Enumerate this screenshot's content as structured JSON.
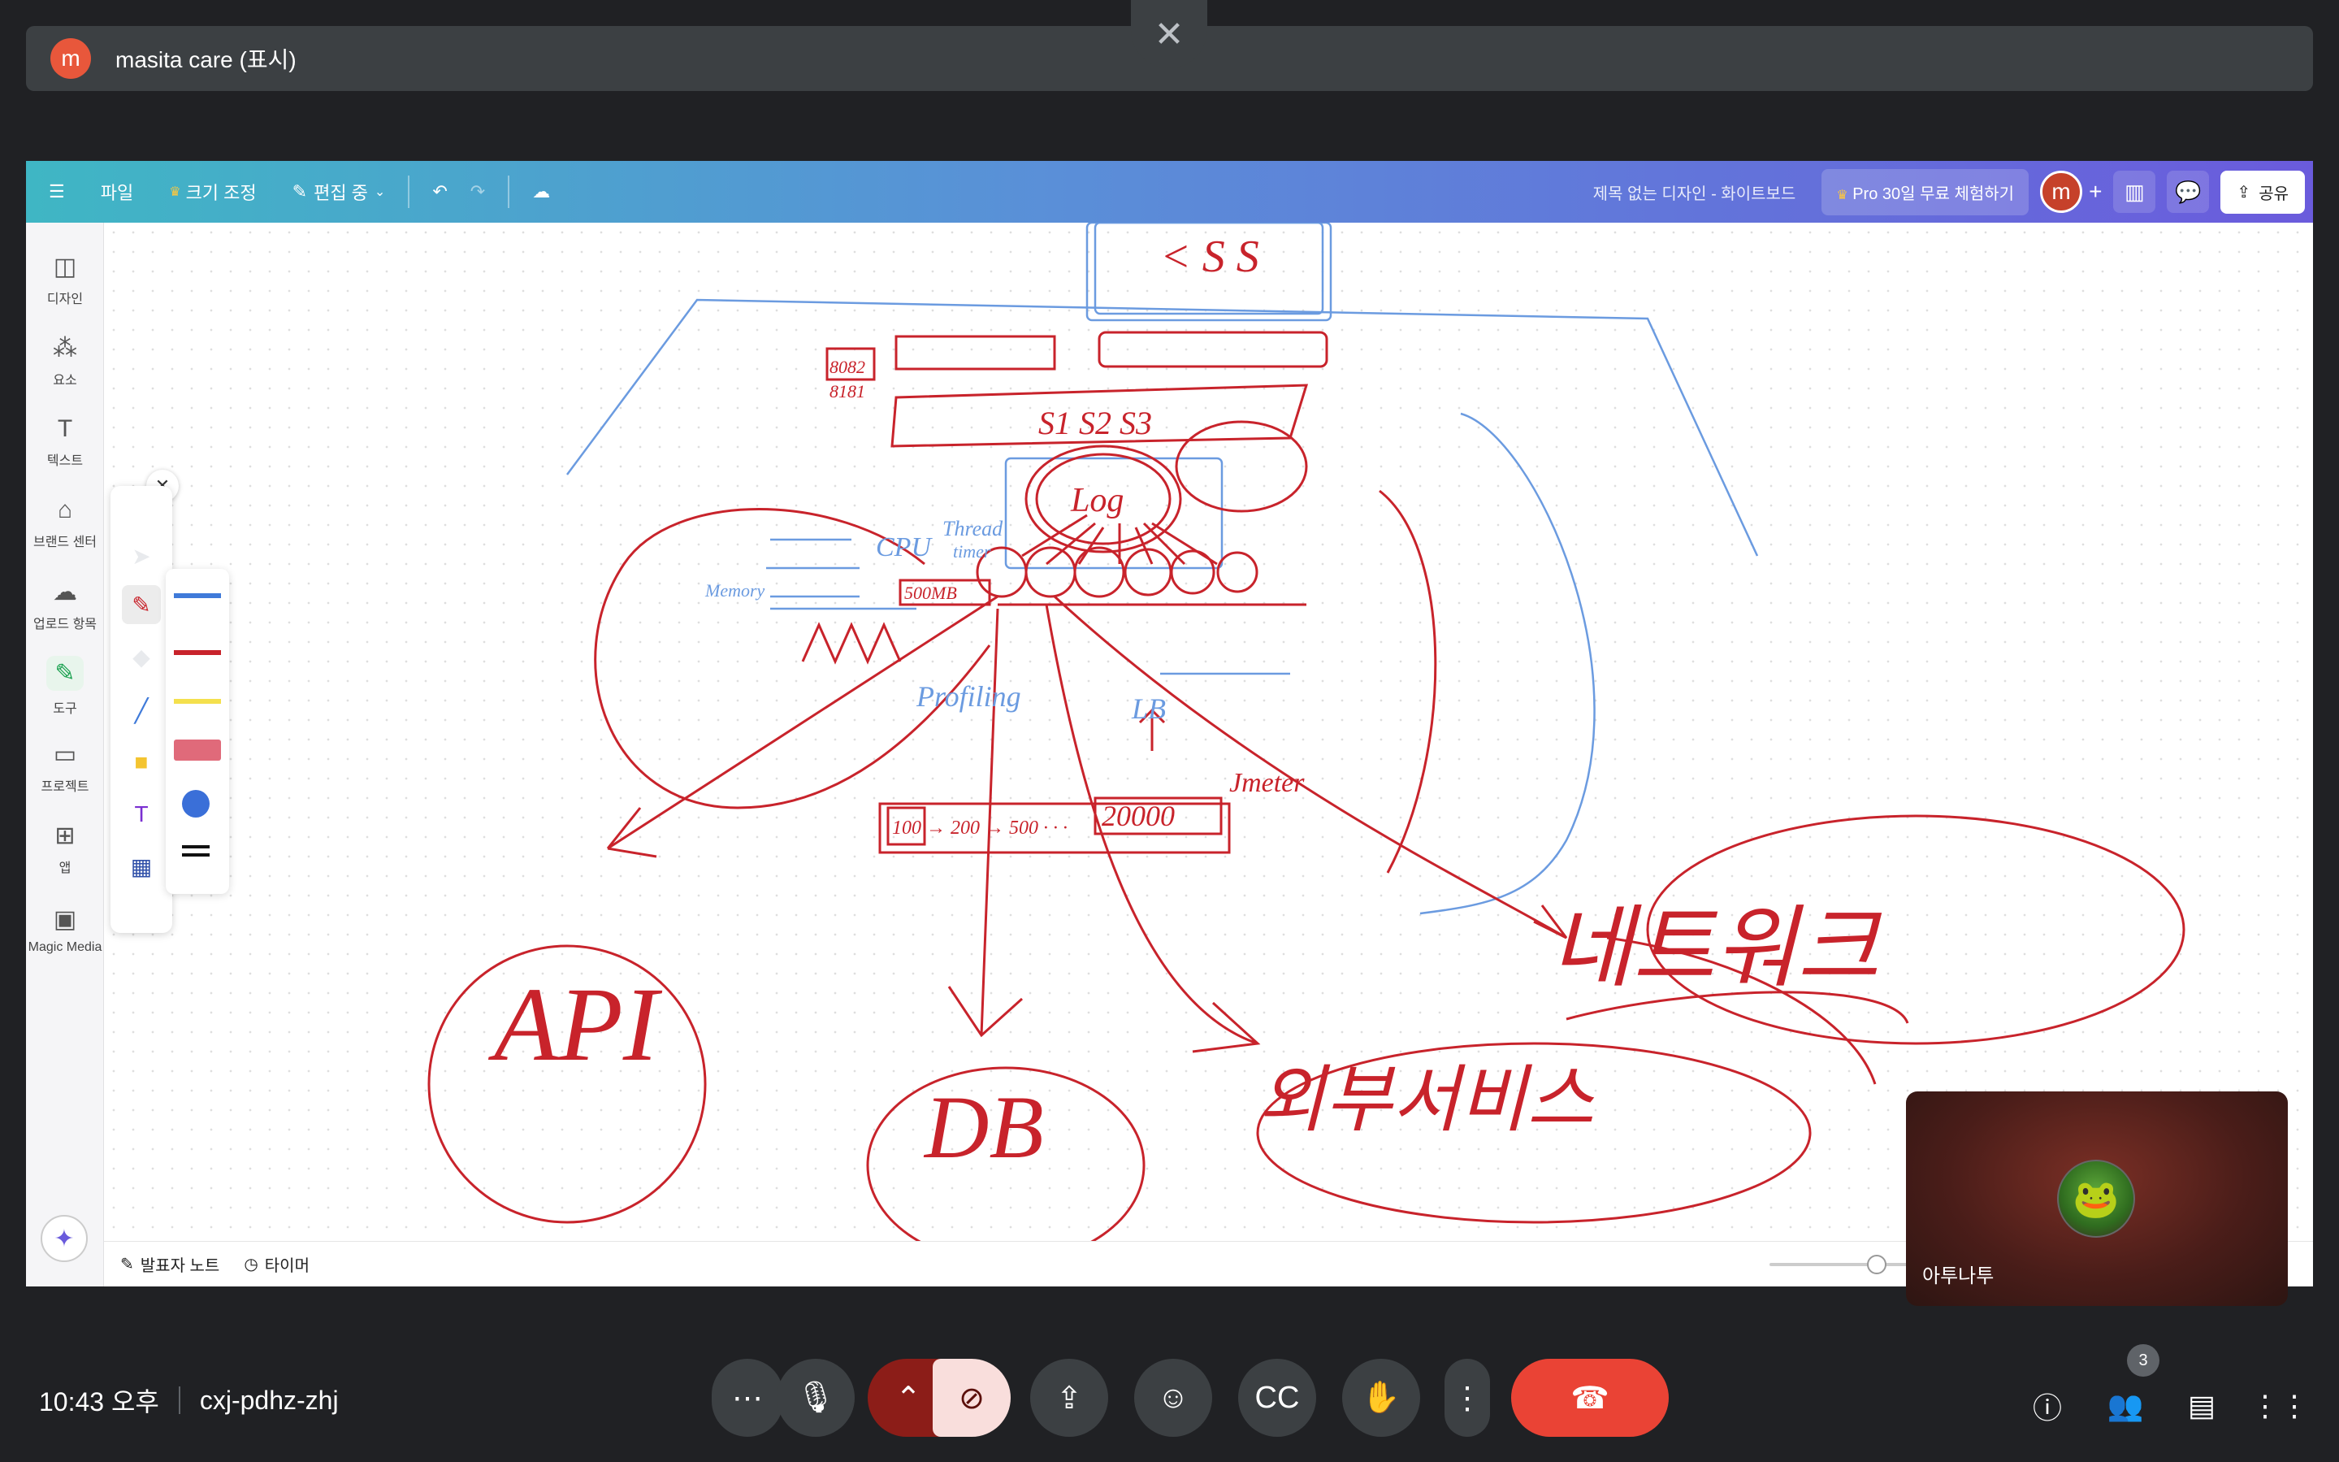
{
  "presenter": {
    "avatar_letter": "m",
    "name": "masita care (표시)"
  },
  "canva": {
    "menu_file": "파일",
    "resize": "크기 조정",
    "editing": "편집 중",
    "doc_title": "제목 없는 디자인 - 화이트보드",
    "pro_trial": "Pro 30일 무료 체험하기",
    "user_avatar": "m",
    "share": "공유",
    "sidebar": [
      {
        "label": "디자인",
        "icon": "layout-icon"
      },
      {
        "label": "요소",
        "icon": "shapes-icon"
      },
      {
        "label": "텍스트",
        "icon": "text-icon"
      },
      {
        "label": "브랜드 센터",
        "icon": "brand-icon"
      },
      {
        "label": "업로드 항목",
        "icon": "upload-icon"
      },
      {
        "label": "도구",
        "icon": "draw-icon"
      },
      {
        "label": "프로젝트",
        "icon": "folder-icon"
      },
      {
        "label": "앱",
        "icon": "apps-icon"
      },
      {
        "label": "Magic Media",
        "icon": "magic-media-icon"
      }
    ],
    "bottom": {
      "notes": "발표자 노트",
      "timer": "타이머"
    },
    "whiteboard_text": {
      "css": "< S S",
      "port_a": "8082",
      "port_b": "8181",
      "servers": "S1 S2 S3",
      "log": "Log",
      "cpu": "CPU",
      "thread": "Thread",
      "timer_word": "timer",
      "memory": "Memory",
      "mem_size": "500MB",
      "profiling": "Profiling",
      "lb": "LB",
      "load_seq": "100 → 200 → 500 · · ·",
      "load_max": "20000",
      "jmeter": "Jmeter",
      "network": "네트워크",
      "api": "API",
      "db": "DB",
      "external": "외부서비스"
    }
  },
  "self_view": {
    "name": "아투나투"
  },
  "meet": {
    "time": "10:43 오후",
    "meeting_code": "cxj-pdhz-zhj",
    "participants_count": "3"
  }
}
